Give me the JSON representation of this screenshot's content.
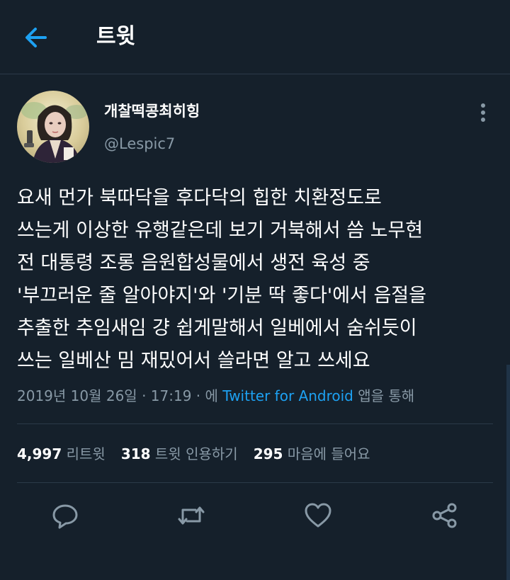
{
  "header": {
    "title": "트윗"
  },
  "author": {
    "name": "개찰떡콩최히힝",
    "handle": "@Lespic7"
  },
  "tweet": {
    "lines": [
      "요새 먼가 북따닥을 후다닥의 힙한 치환정도로",
      "쓰는게 이상한 유행같은데 보기 거북해서 씀 노무현",
      "전 대통령 조롱 음원합성물에서 생전 육성 중",
      "'부끄러운 줄 알아야지'와 '기분 딱 좋다'에서 음절을",
      "추출한 추임새임 걍 쉽게말해서 일베에서 숨쉬듯이",
      "쓰는 일베산 밈 재밌어서 쓸라면 알고 쓰세요"
    ]
  },
  "meta": {
    "date": "2019년 10월 26일",
    "sep1": " · ",
    "time": "17:19",
    "sep2": " · 에 ",
    "source": "Twitter for Android",
    "suffix": " 앱을 통해"
  },
  "stats": {
    "retweets": "4,997",
    "retweets_label": " 리트윗",
    "quotes": "318",
    "quotes_label": " 트윗 인용하기",
    "likes": "295",
    "likes_label": " 마음에 들어요"
  },
  "actions": {
    "icons": [
      "reply-icon",
      "retweet-icon",
      "like-icon",
      "share-icon"
    ]
  },
  "colors": {
    "background": "#15202b",
    "accent": "#1da1f2",
    "secondary_text": "#8899a6",
    "divider": "#2b3a49"
  }
}
